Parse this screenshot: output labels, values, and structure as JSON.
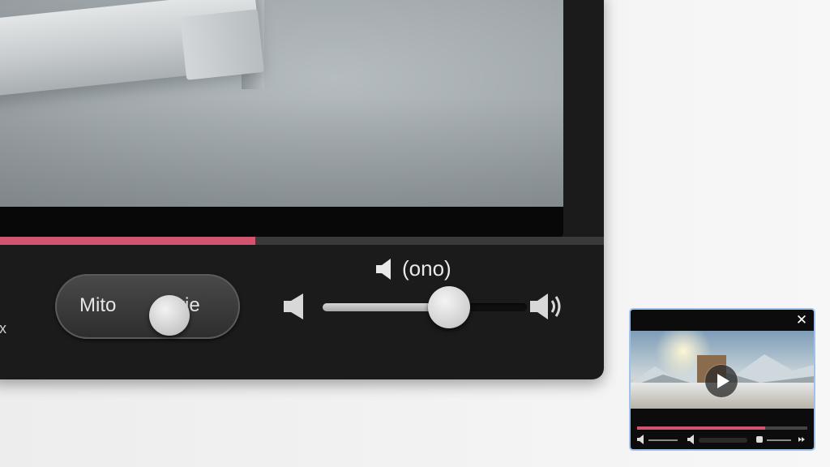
{
  "main_player": {
    "progress_fraction": 0.43,
    "edge_label": "x",
    "toggle": {
      "left_label": "Mito",
      "right_label": "rie"
    },
    "volume": {
      "label": "(ono)",
      "level_fraction": 0.62,
      "icons": [
        "speaker-icon",
        "volume-low-icon",
        "volume-high-icon"
      ]
    },
    "accent_color": "#d2556f"
  },
  "mini_player": {
    "close_glyph": "✕",
    "progress_fraction": 0.75,
    "buffered_fraction": 0.28,
    "icons": [
      "play-icon",
      "volume-icon",
      "settings-icon",
      "skip-icon"
    ],
    "border_color": "#9fc3e8"
  }
}
